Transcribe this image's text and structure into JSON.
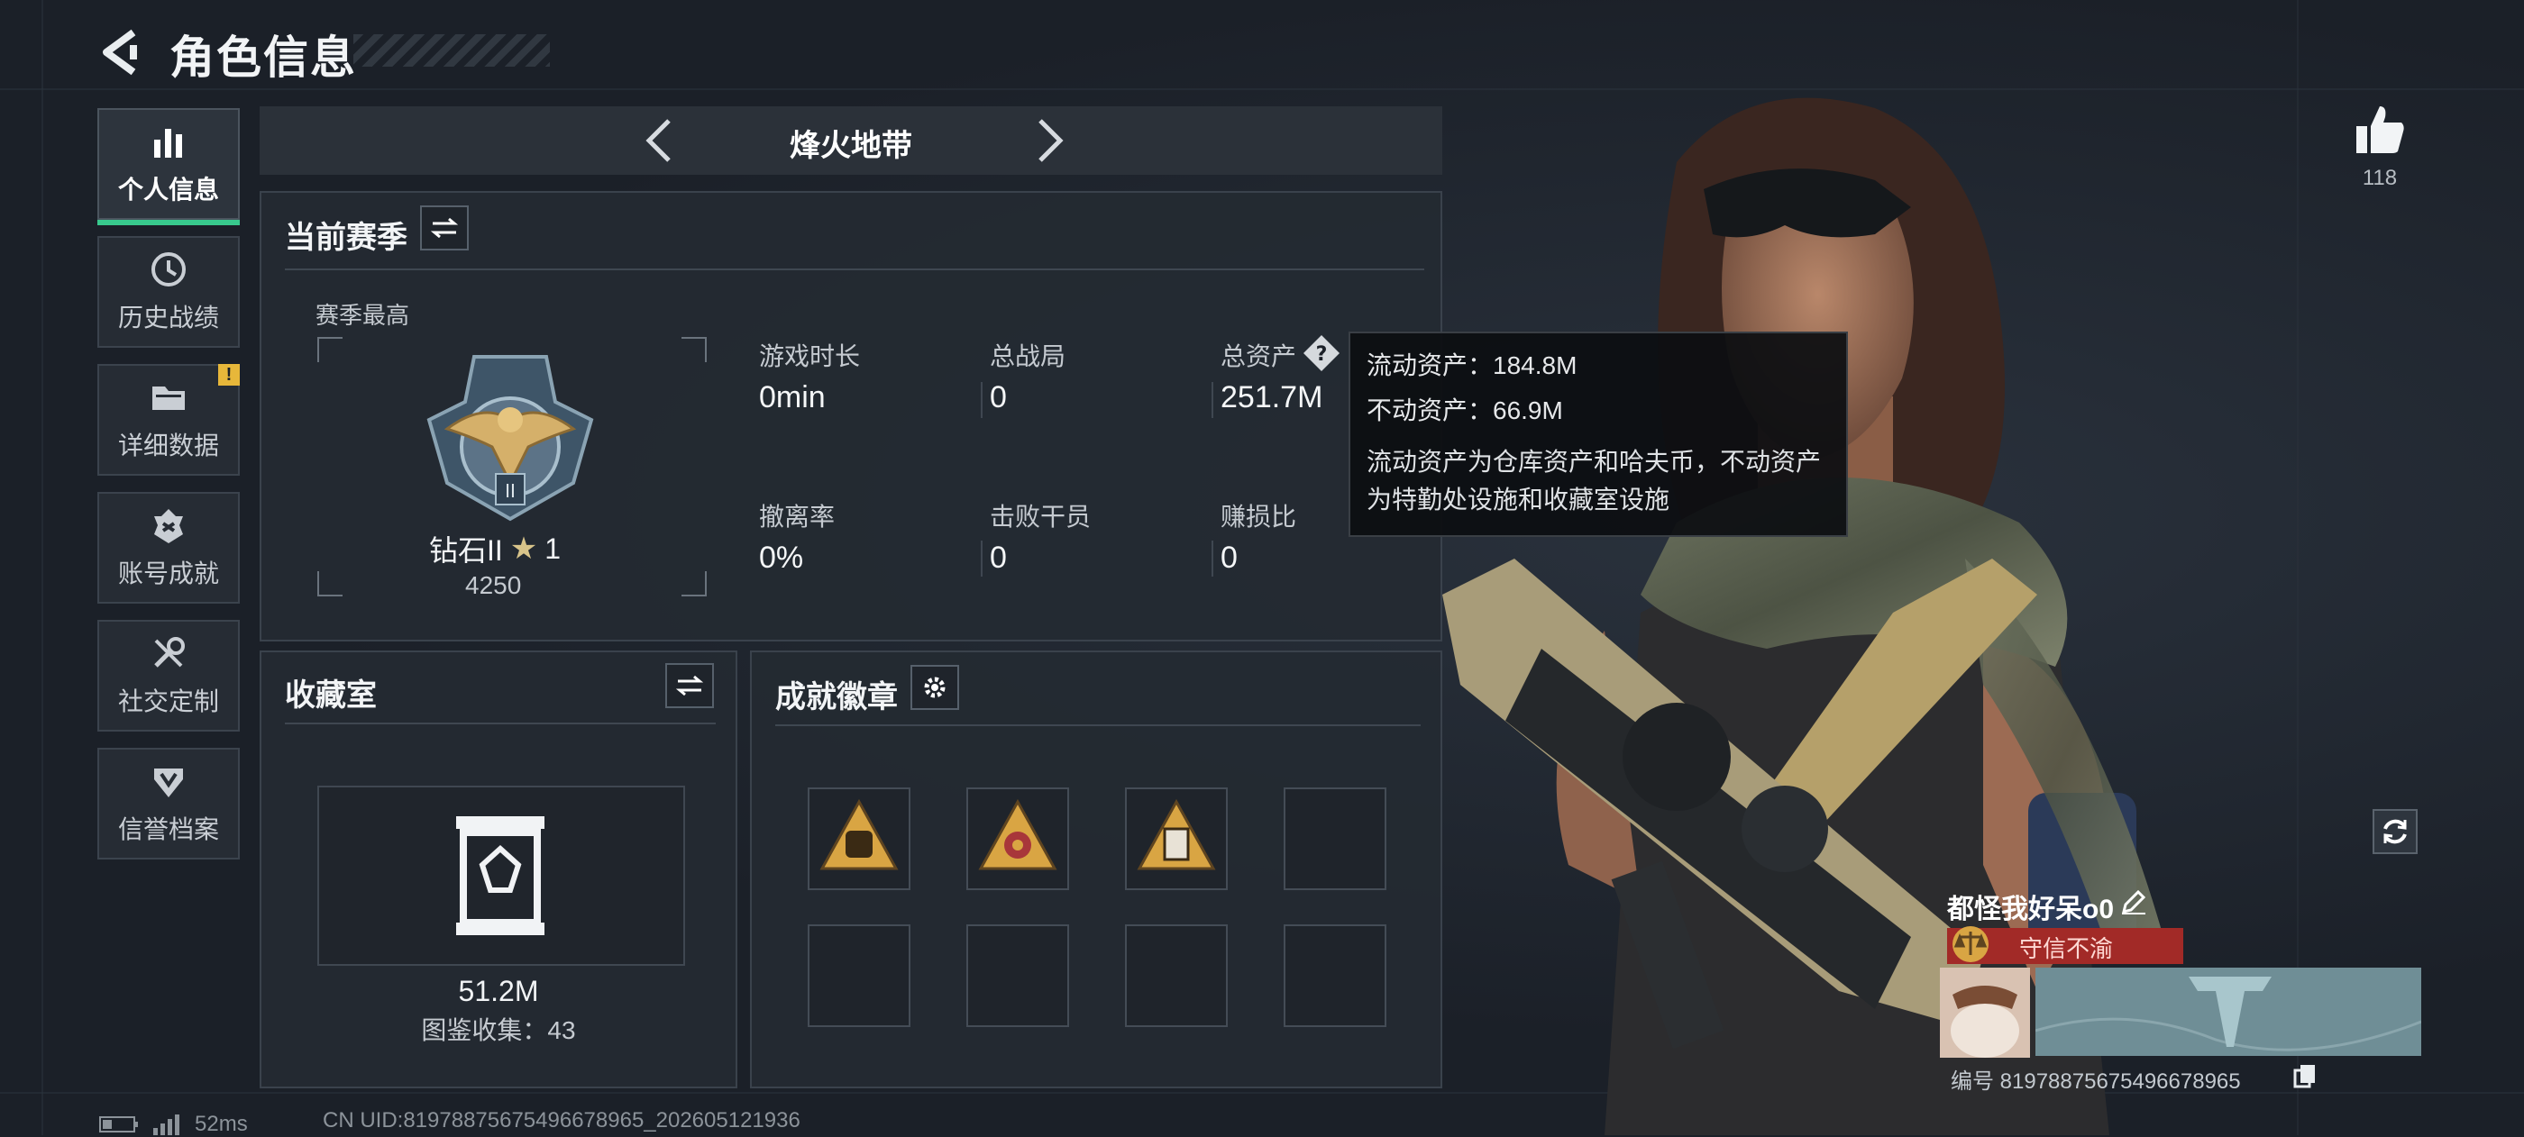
{
  "header": {
    "title": "角色信息"
  },
  "sidebar": {
    "items": [
      {
        "label": "个人信息",
        "icon": "bar-chart-icon",
        "active": true
      },
      {
        "label": "历史战绩",
        "icon": "history-clock-icon"
      },
      {
        "label": "详细数据",
        "icon": "folder-icon",
        "badge": "!"
      },
      {
        "label": "账号成就",
        "icon": "achievement-icon"
      },
      {
        "label": "社交定制",
        "icon": "tools-icon"
      },
      {
        "label": "信誉档案",
        "icon": "reputation-shield-icon"
      }
    ]
  },
  "mode": {
    "name": "烽火地带"
  },
  "season": {
    "title": "当前赛季",
    "best_label": "赛季最高",
    "rank_name": "钻石II",
    "rank_stars": "1",
    "rank_score": "4250",
    "stats": [
      {
        "label": "游戏时长",
        "value": "0min"
      },
      {
        "label": "总战局",
        "value": "0"
      },
      {
        "label": "总资产",
        "value": "251.7M"
      },
      {
        "label": "撤离率",
        "value": "0%"
      },
      {
        "label": "击败干员",
        "value": "0"
      },
      {
        "label": "赚损比",
        "value": "0"
      }
    ]
  },
  "tooltip": {
    "liquid": "流动资产：184.8M",
    "fixed": "不动资产：66.9M",
    "desc": "流动资产为仓库资产和哈夫币，不动资产为特勤处设施和收藏室设施"
  },
  "collection": {
    "title": "收藏室",
    "value": "51.2M",
    "count_text": "图鉴收集：43"
  },
  "badges": {
    "title": "成就徽章",
    "slots": 8,
    "filled": 3
  },
  "profile": {
    "likes": "118",
    "name": "都怪我好呆o0",
    "honor": "守信不渝",
    "id_text": "编号 8197887567549667896​5"
  },
  "footer": {
    "ping": "52ms",
    "uid": "CN UID:8197887567549667896​5_202605121936"
  },
  "colors": {
    "accent": "#38c98d",
    "honor_red": "#a22a27",
    "badge_gold": "#d9a543"
  }
}
